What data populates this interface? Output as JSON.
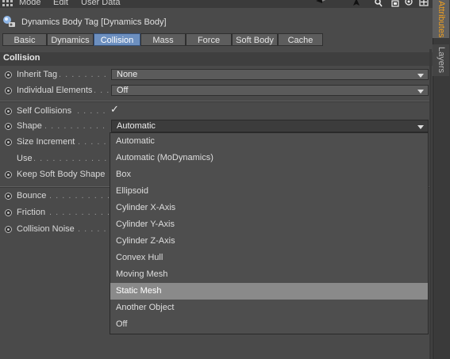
{
  "menubar": {
    "items": [
      "Mode",
      "Edit",
      "User Data"
    ],
    "icons": [
      "arrow-left-icon",
      "cursor-icon",
      "search-icon",
      "lock-icon",
      "target-icon",
      "add-icon"
    ]
  },
  "panel": {
    "title": "Dynamics Body Tag [Dynamics Body]"
  },
  "tabs": [
    {
      "label": "Basic",
      "active": false
    },
    {
      "label": "Dynamics",
      "active": false
    },
    {
      "label": "Collision",
      "active": true
    },
    {
      "label": "Mass",
      "active": false
    },
    {
      "label": "Force",
      "active": false
    },
    {
      "label": "Soft Body",
      "active": false
    },
    {
      "label": "Cache",
      "active": false
    }
  ],
  "section": {
    "title": "Collision"
  },
  "params": {
    "inherit_tag": {
      "label": "Inherit Tag",
      "value": "None"
    },
    "individual_elements": {
      "label": "Individual Elements",
      "value": "Off"
    },
    "self_collisions": {
      "label": "Self Collisions",
      "checked": true,
      "check_glyph": "✓"
    },
    "shape": {
      "label": "Shape",
      "value": "Automatic"
    },
    "size_increment": {
      "label": "Size Increment"
    },
    "use": {
      "label": "Use"
    },
    "keep_soft_body_shape": {
      "label": "Keep Soft Body Shape"
    },
    "bounce": {
      "label": "Bounce"
    },
    "friction": {
      "label": "Friction"
    },
    "collision_noise": {
      "label": "Collision Noise"
    }
  },
  "shape_dropdown": {
    "options": [
      "Automatic",
      "Automatic (MoDynamics)",
      "Box",
      "Ellipsoid",
      "Cylinder X-Axis",
      "Cylinder Y-Axis",
      "Cylinder Z-Axis",
      "Convex Hull",
      "Moving Mesh",
      "Static Mesh",
      "Another Object",
      "Off"
    ],
    "highlighted": "Static Mesh"
  },
  "sidebar": {
    "tabs": [
      "Attributes",
      "Layers"
    ],
    "active_tab": "Attributes"
  },
  "colors": {
    "accent_tab": "#6c8fbf",
    "attributes_tab_text": "#f0a020",
    "highlight": "#8a8a8a"
  }
}
